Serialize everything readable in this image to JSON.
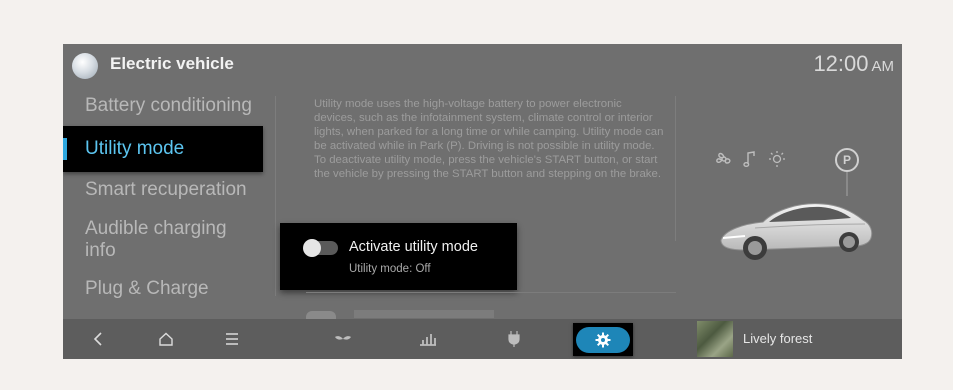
{
  "header": {
    "title": "Electric vehicle",
    "time": "12:00",
    "ampm": "AM"
  },
  "sidebar": {
    "items": [
      {
        "label": "Battery conditioning"
      },
      {
        "label": "Utility mode",
        "active": true
      },
      {
        "label": "Smart recuperation"
      },
      {
        "label": "Audible charging info"
      },
      {
        "label": "Plug & Charge"
      }
    ]
  },
  "main": {
    "description": "Utility mode uses the high-voltage battery to power electronic devices, such as the infotainment system, climate control or interior lights, when parked for a long time or while camping. Utility mode can be activated while in Park (P). Driving is not possible in utility mode. To deactivate utility mode, press the vehicle's START button, or start the vehicle by pressing the START button and stepping on the brake.",
    "toggle": {
      "label": "Activate utility mode",
      "status": "Utility mode: Off",
      "state": "off"
    }
  },
  "car_panel": {
    "icons": [
      "fan-icon",
      "music-note-icon",
      "light-bulb-icon"
    ],
    "gear": "P"
  },
  "bottom_bar": {
    "icons": [
      "back-icon",
      "home-icon",
      "menu-icon",
      "leaf-icon",
      "energy-bars-icon",
      "charging-plug-icon",
      "gear-icon"
    ],
    "active": "gear-icon",
    "media_title": "Lively forest"
  },
  "colors": {
    "accent": "#5cc5f0",
    "settings_active": "#1e86b8",
    "background": "#6f6f6f"
  }
}
